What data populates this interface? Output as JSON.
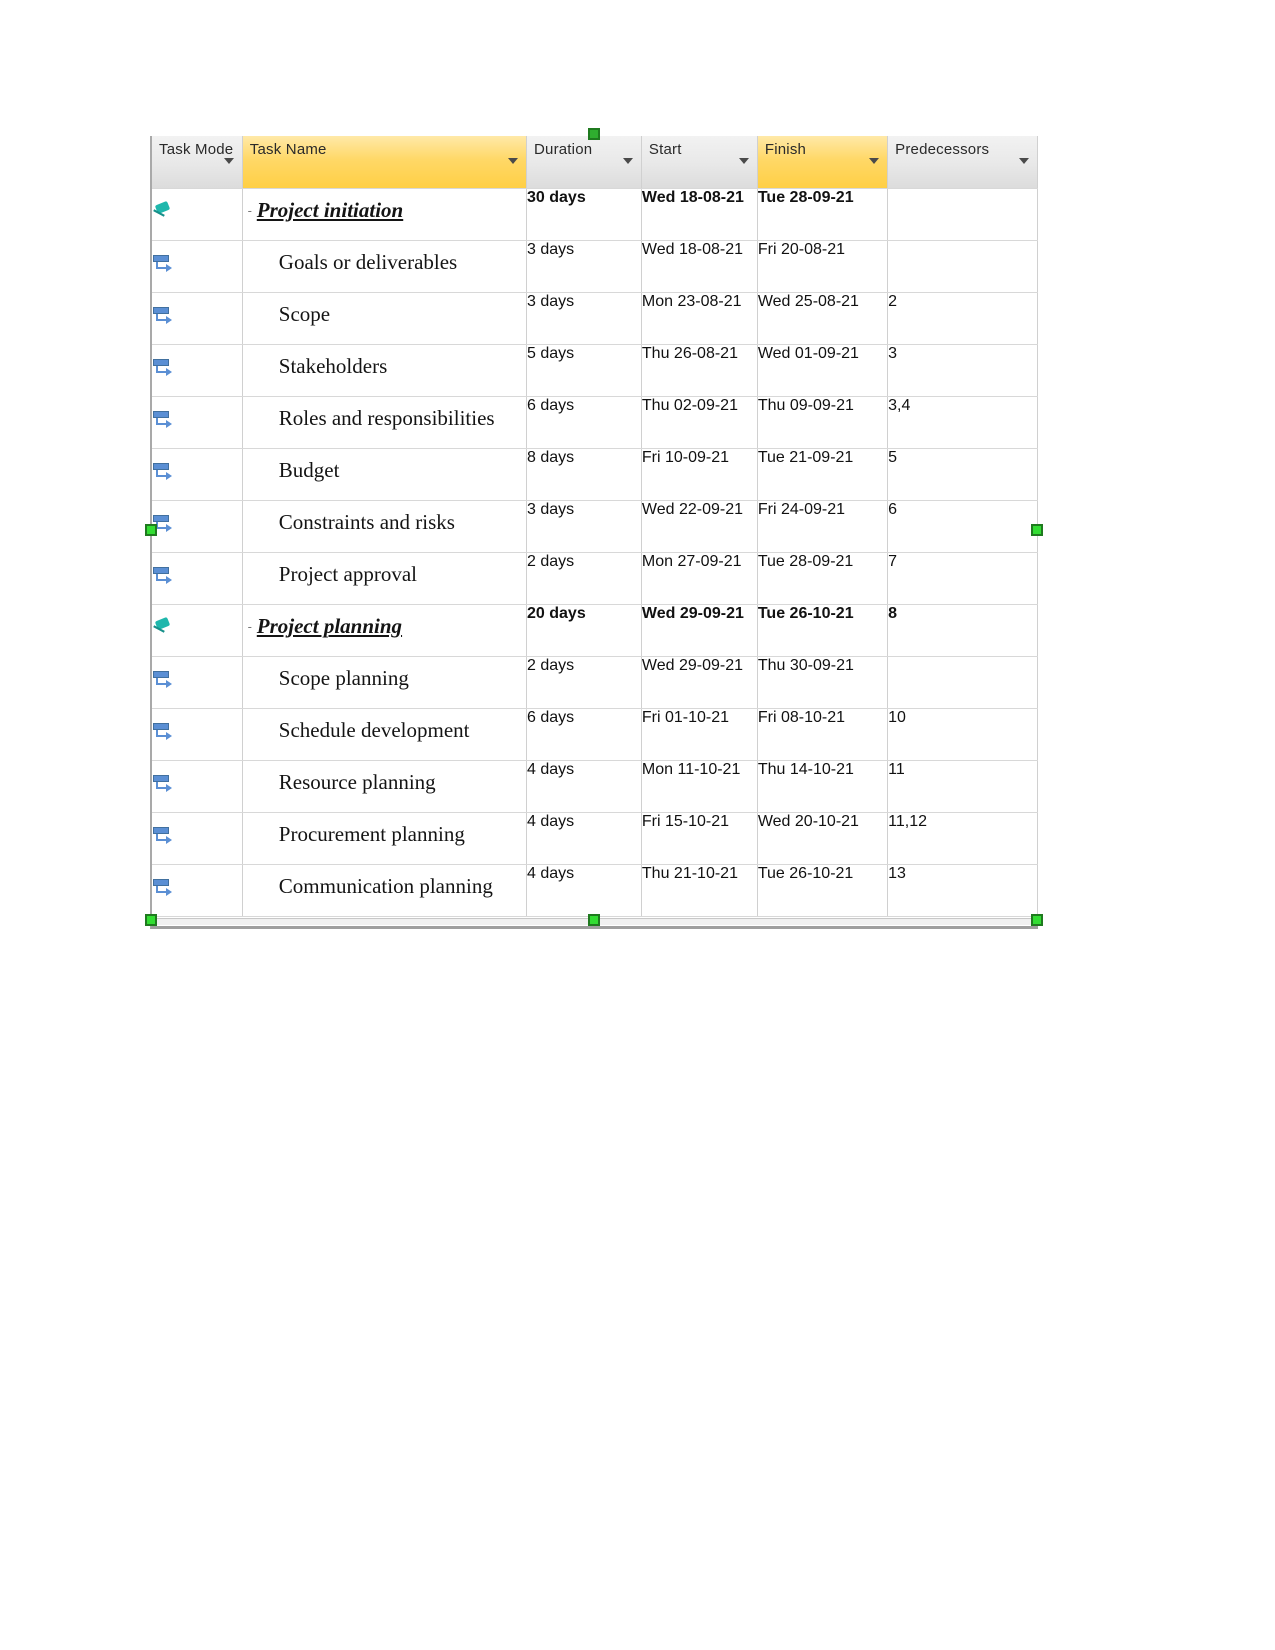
{
  "app": {
    "title": "Microsoft Project task entry table",
    "accent_header": "#ffd867",
    "accent_selection_handle": "#33dd33",
    "accent_summary_icon": "#1fb7ac",
    "accent_auto_icon": "#5b8fd4"
  },
  "columns": [
    {
      "key": "mode",
      "label": "Task Mode",
      "highlighted": false,
      "has_filter": true
    },
    {
      "key": "name",
      "label": "Task Name",
      "highlighted": true,
      "has_filter": true
    },
    {
      "key": "dur",
      "label": "Duration",
      "highlighted": false,
      "has_filter": true
    },
    {
      "key": "start",
      "label": "Start",
      "highlighted": false,
      "has_filter": true
    },
    {
      "key": "finish",
      "label": "Finish",
      "highlighted": true,
      "has_filter": true
    },
    {
      "key": "pred",
      "label": "Predecessors",
      "highlighted": false,
      "has_filter": true
    }
  ],
  "rows": [
    {
      "mode_icon": "pin-icon",
      "summary": true,
      "indent": 0,
      "toggle": "-",
      "name": "Project initiation",
      "duration": "30 days",
      "start": "Wed 18-08-21",
      "finish": "Tue 28-09-21",
      "predecessors": ""
    },
    {
      "mode_icon": "auto-schedule-icon",
      "summary": false,
      "indent": 1,
      "toggle": "",
      "name": "Goals or deliverables",
      "duration": "3 days",
      "start": "Wed 18-08-21",
      "finish": "Fri 20-08-21",
      "predecessors": ""
    },
    {
      "mode_icon": "auto-schedule-icon",
      "summary": false,
      "indent": 1,
      "toggle": "",
      "name": "Scope",
      "duration": "3 days",
      "start": "Mon 23-08-21",
      "finish": "Wed 25-08-21",
      "predecessors": "2"
    },
    {
      "mode_icon": "auto-schedule-icon",
      "summary": false,
      "indent": 1,
      "toggle": "",
      "name": "Stakeholders",
      "duration": "5 days",
      "start": "Thu 26-08-21",
      "finish": "Wed 01-09-21",
      "predecessors": "3"
    },
    {
      "mode_icon": "auto-schedule-icon",
      "summary": false,
      "indent": 1,
      "toggle": "",
      "name": "Roles and responsibilities",
      "duration": "6 days",
      "start": "Thu 02-09-21",
      "finish": "Thu 09-09-21",
      "predecessors": "3,4"
    },
    {
      "mode_icon": "auto-schedule-icon",
      "summary": false,
      "indent": 1,
      "toggle": "",
      "name": "Budget",
      "duration": "8 days",
      "start": "Fri 10-09-21",
      "finish": "Tue 21-09-21",
      "predecessors": "5"
    },
    {
      "mode_icon": "auto-schedule-icon",
      "summary": false,
      "indent": 1,
      "toggle": "",
      "name": "Constraints and risks",
      "duration": "3 days",
      "start": "Wed 22-09-21",
      "finish": "Fri 24-09-21",
      "predecessors": "6"
    },
    {
      "mode_icon": "auto-schedule-icon",
      "summary": false,
      "indent": 1,
      "toggle": "",
      "name": "Project approval",
      "duration": "2 days",
      "start": "Mon 27-09-21",
      "finish": "Tue 28-09-21",
      "predecessors": "7"
    },
    {
      "mode_icon": "pin-icon",
      "summary": true,
      "indent": 0,
      "toggle": "-",
      "name": "Project planning",
      "duration": "20 days",
      "start": "Wed 29-09-21",
      "finish": "Tue 26-10-21",
      "predecessors": "8"
    },
    {
      "mode_icon": "auto-schedule-icon",
      "summary": false,
      "indent": 1,
      "toggle": "",
      "name": "Scope planning",
      "duration": "2 days",
      "start": "Wed 29-09-21",
      "finish": "Thu 30-09-21",
      "predecessors": ""
    },
    {
      "mode_icon": "auto-schedule-icon",
      "summary": false,
      "indent": 1,
      "toggle": "",
      "name": "Schedule development",
      "duration": "6 days",
      "start": "Fri 01-10-21",
      "finish": "Fri 08-10-21",
      "predecessors": "10"
    },
    {
      "mode_icon": "auto-schedule-icon",
      "summary": false,
      "indent": 1,
      "toggle": "",
      "name": "Resource planning",
      "duration": "4 days",
      "start": "Mon 11-10-21",
      "finish": "Thu 14-10-21",
      "predecessors": "11"
    },
    {
      "mode_icon": "auto-schedule-icon",
      "summary": false,
      "indent": 1,
      "toggle": "",
      "name": "Procurement planning",
      "duration": "4 days",
      "start": "Fri 15-10-21",
      "finish": "Wed 20-10-21",
      "predecessors": "11,12"
    },
    {
      "mode_icon": "auto-schedule-icon",
      "summary": false,
      "indent": 1,
      "toggle": "",
      "name": "Communication planning",
      "duration": "4 days",
      "start": "Thu 21-10-21",
      "finish": "Tue 26-10-21",
      "predecessors": "13"
    }
  ]
}
